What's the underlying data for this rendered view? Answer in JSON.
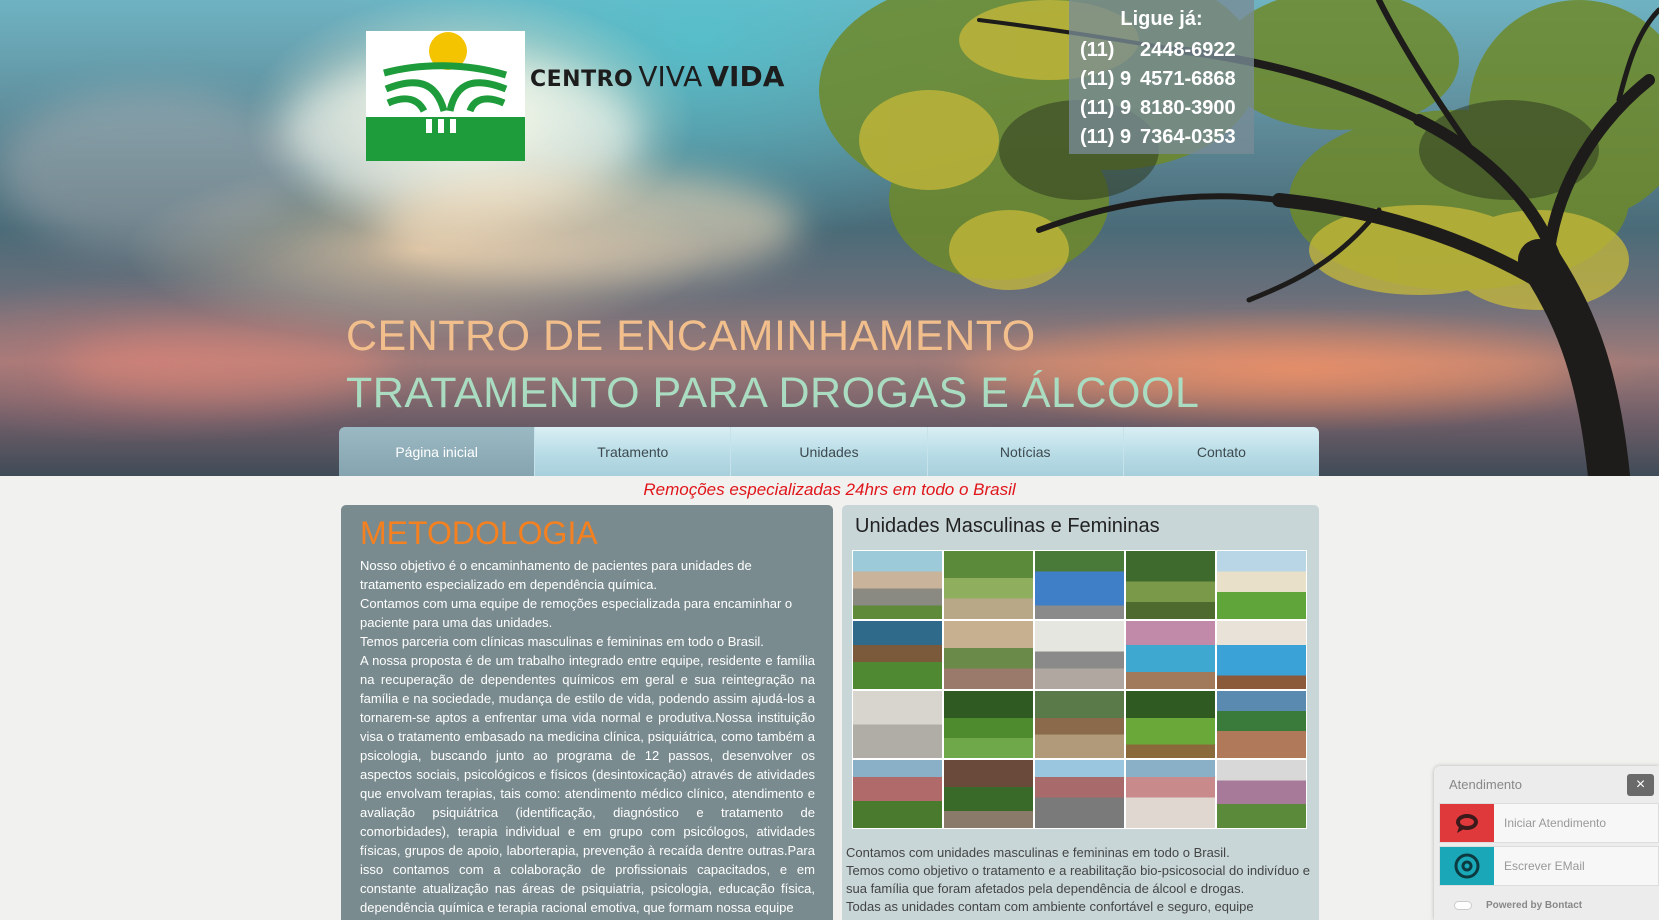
{
  "brand": {
    "logo_word1": "CENTRO",
    "logo_word2": "VIVA",
    "logo_word3": "VIDA",
    "logo_colors": {
      "sun": "#f5c400",
      "green": "#1e9b3a"
    }
  },
  "contact_box": {
    "title": "Ligue já:",
    "phones": [
      {
        "area": "(11)",
        "number": "2448-6922"
      },
      {
        "area": "(11) 9",
        "number": "4571-6868"
      },
      {
        "area": "(11) 9",
        "number": "8180-3900"
      },
      {
        "area": "(11) 9",
        "number": "7364-0353"
      }
    ]
  },
  "hero": {
    "headline1": "CENTRO DE ENCAMINHAMENTO",
    "headline2": "TRATAMENTO PARA DROGAS E ÁLCOOL"
  },
  "nav": {
    "items": [
      {
        "label": "Página inicial",
        "active": true
      },
      {
        "label": "Tratamento",
        "active": false
      },
      {
        "label": "Unidades",
        "active": false
      },
      {
        "label": "Notícias",
        "active": false
      },
      {
        "label": "Contato",
        "active": false
      }
    ]
  },
  "tagline": "Remoções especializadas 24hrs em todo o Brasil",
  "metodologia": {
    "title": "METODOLOGIA",
    "p1": "Nosso objetivo é o encaminhamento de pacientes para unidades de tratamento especializado em dependência química.",
    "p2": "Contamos com uma equipe de remoções especializada para encaminhar o paciente para uma das unidades.",
    "p3": "Temos parceria com clínicas masculinas e femininas em todo o Brasil.",
    "p4": "A nossa proposta é de um trabalho integrado entre equipe, residente e família na recuperação de dependentes químicos em geral e sua reintegração na família e na sociedade, mudança de estilo de vida, podendo assim ajudá-los a tornarem-se aptos a enfrentar uma vida normal e produtiva.Nossa instituição visa o tratamento embasado na medicina clínica, psiquiátrica, como também a psicologia, buscando junto ao programa de 12 passos, desenvolver os aspectos sociais, psicológicos e físicos (desintoxicação) através de atividades que envolvam terapias, tais como: atendimento médico clínico, atendimento e avaliação psiquiátrica (identificação, diagnóstico e tratamento de comorbidades), terapia individual e em grupo com psicólogos, atividades físicas, grupos de apoio, laborterapia, prevenção à recaída dentre outras.Para isso contamos com a colaboração de profissionais capacitados, e em constante atualização nas áreas de psiquiatria, psicologia, educação física, dependência química e terapia racional emotiva, que formam nossa equipe"
  },
  "unidades": {
    "title": "Unidades Masculinas e Femininas",
    "desc1": "Contamos com unidades masculinas e femininas em todo o Brasil.",
    "desc2": "Temos como objetivo o tratamento e a reabilitação bio-psicosocial do indivíduo e sua família que foram afetados pela dependência de álcool e drogas.",
    "desc3": "Todas as unidades contam com ambiente confortável e seguro, equipe"
  },
  "chat": {
    "title": "Atendimento",
    "close": "×",
    "start_label": "Iniciar Atendimento",
    "email_label": "Escrever EMail",
    "powered": "Powered by Bontact",
    "start_color": "#e0393c",
    "email_color": "#1aa8b8"
  }
}
